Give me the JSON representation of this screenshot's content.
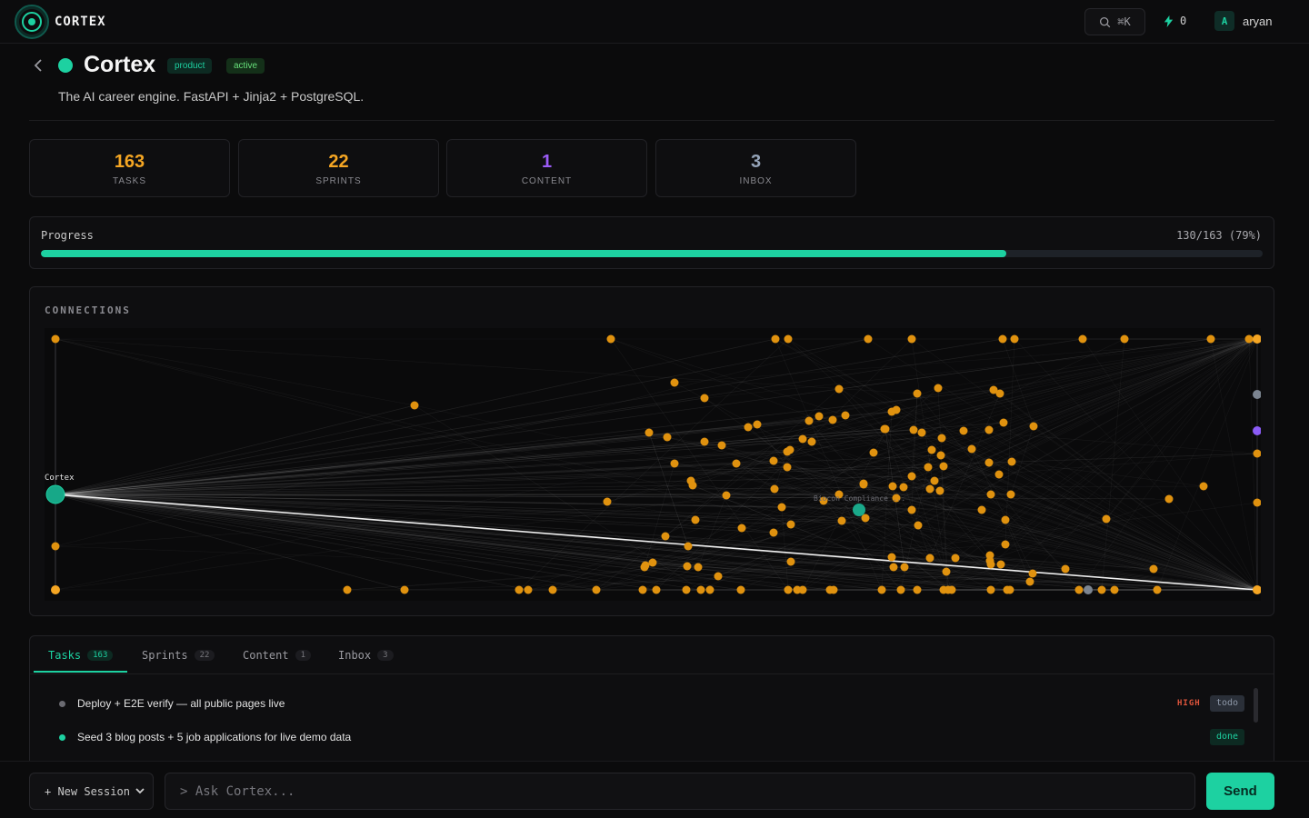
{
  "app": {
    "brand": "CORTEX",
    "accent": "#1dd1a1"
  },
  "header": {
    "search_label": "⌘K",
    "bolt_count": "0",
    "avatar_initial": "A",
    "username": "aryan"
  },
  "project": {
    "title": "Cortex",
    "tags": [
      "product",
      "active"
    ],
    "description": "The AI career engine. FastAPI + Jinja2 + PostgreSQL."
  },
  "stats": [
    {
      "value": "163",
      "label": "TASKS",
      "color": "#f5a623"
    },
    {
      "value": "22",
      "label": "SPRINTS",
      "color": "#f5a623"
    },
    {
      "value": "1",
      "label": "CONTENT",
      "color": "#9b5cf6"
    },
    {
      "value": "3",
      "label": "INBOX",
      "color": "#94a3b8"
    }
  ],
  "progress": {
    "label": "Progress",
    "value_text": "130/163 (79%)",
    "fraction": 0.79
  },
  "connections": {
    "title": "CONNECTIONS",
    "hub_label": "Cortex",
    "focus_label": "Biocon Compliance ..."
  },
  "tabs": [
    {
      "label": "Tasks",
      "count": "163"
    },
    {
      "label": "Sprints",
      "count": "22"
    },
    {
      "label": "Content",
      "count": "1"
    },
    {
      "label": "Inbox",
      "count": "3"
    }
  ],
  "tasks": [
    {
      "title": "Deploy + E2E verify — all public pages live",
      "priority": "HIGH",
      "status": "todo"
    },
    {
      "title": "Seed 3 blog posts + 5 job applications for live demo data",
      "priority": "",
      "status": "done"
    }
  ],
  "bottom": {
    "session_label": "+ New Session",
    "ask_placeholder": "> Ask Cortex...",
    "send_label": "Send"
  }
}
